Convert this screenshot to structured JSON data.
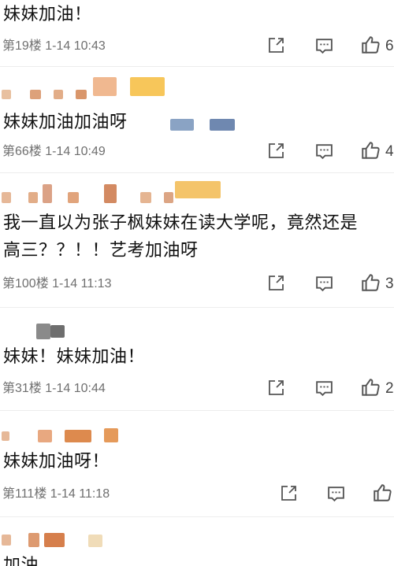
{
  "comments": [
    {
      "text_lines": [
        "妹妹加油！"
      ],
      "floor": "第19楼",
      "time": "1-14 10:43",
      "like_count": "6"
    },
    {
      "text_lines": [
        "妹妹加油加油呀"
      ],
      "floor": "第66楼",
      "time": "1-14 10:49",
      "like_count": "4"
    },
    {
      "text_lines": [
        "我一直以为张子枫妹妹在读大学呢，竟然还是",
        "高三？？！！艺考加油呀"
      ],
      "floor": "第100楼",
      "time": "1-14 11:13",
      "like_count": "3"
    },
    {
      "text_lines": [
        "妹妹！妹妹加油！"
      ],
      "floor": "第31楼",
      "time": "1-14 10:44",
      "like_count": "2"
    },
    {
      "text_lines": [
        "妹妹加油呀！"
      ],
      "floor": "第111楼",
      "time": "1-14 11:18",
      "like_count": ""
    },
    {
      "text_lines": [
        "加油"
      ],
      "floor": "",
      "time": "",
      "like_count": ""
    }
  ],
  "icons": {
    "share": "share-icon",
    "reply": "comment-icon",
    "like": "thumbs-up-icon"
  },
  "colors": {
    "text": "#111111",
    "meta": "#6f6f6f",
    "icon": "#555555",
    "separator": "#ededed"
  }
}
